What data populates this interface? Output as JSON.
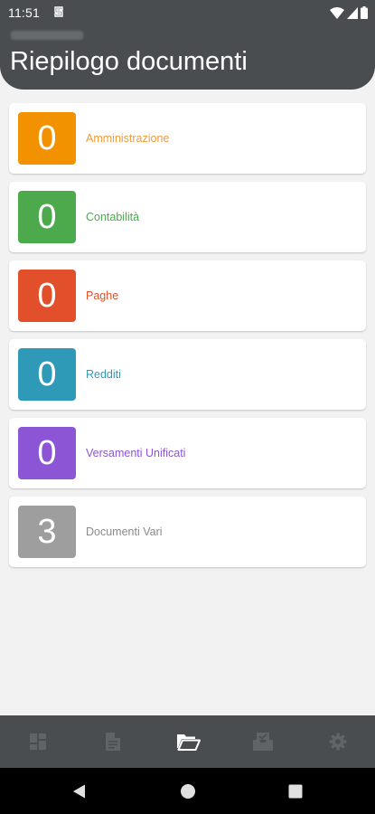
{
  "status_bar": {
    "time": "11:51"
  },
  "header": {
    "title": "Riepilogo documenti"
  },
  "categories": [
    {
      "count": "0",
      "label": "Amministrazione",
      "color": "#f39200",
      "text_color": "#f39a3b"
    },
    {
      "count": "0",
      "label": "Contabilità",
      "color": "#4caa4c",
      "text_color": "#4caa4c"
    },
    {
      "count": "0",
      "label": "Paghe",
      "color": "#e1502b",
      "text_color": "#e1502b"
    },
    {
      "count": "0",
      "label": "Redditi",
      "color": "#2f9ab8",
      "text_color": "#2f9ab8"
    },
    {
      "count": "0",
      "label": "Versamenti Unificati",
      "color": "#8b55d6",
      "text_color": "#8b55d6"
    },
    {
      "count": "3",
      "label": "Documenti Vari",
      "color": "#9e9e9e",
      "text_color": "#8a8a8a"
    }
  ],
  "bottom_nav": [
    {
      "icon": "dashboard-icon",
      "active": false
    },
    {
      "icon": "document-icon",
      "active": false
    },
    {
      "icon": "folder-open-icon",
      "active": true
    },
    {
      "icon": "inbox-icon",
      "active": false
    },
    {
      "icon": "gear-icon",
      "active": false
    }
  ],
  "colors": {
    "header_bg": "#4a4d4f",
    "page_bg": "#f2f2f2",
    "nav_inactive": "#616466",
    "nav_active": "#ffffff"
  }
}
